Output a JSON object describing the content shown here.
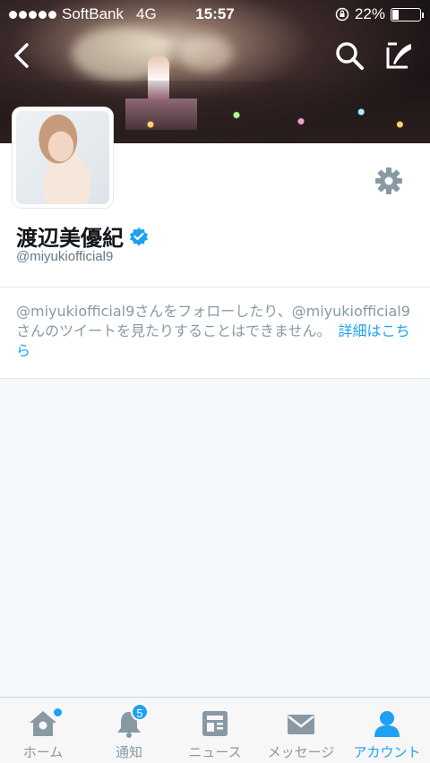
{
  "status_bar": {
    "carrier": "SoftBank",
    "network": "4G",
    "time": "15:57",
    "battery_text": "22%",
    "battery_level": 0.22,
    "signal_bars_filled": 5
  },
  "header": {
    "back_icon": "chevron-left-icon",
    "search_icon": "search-icon",
    "compose_icon": "compose-tweet-icon"
  },
  "profile": {
    "name": "渡辺美優紀",
    "handle": "@miyukiofficial9",
    "verified": true,
    "settings_icon": "gear-icon"
  },
  "protected_notice": {
    "text": "@miyukiofficial9さんをフォローしたり、@miyukiofficial9さんのツイートを見たりすることはできません。",
    "link_label": "詳細はこちら"
  },
  "tabbar": {
    "tabs": [
      {
        "label": "ホーム",
        "icon": "home-icon",
        "active": false,
        "dot": true
      },
      {
        "label": "通知",
        "icon": "bell-icon",
        "active": false,
        "badge": "5"
      },
      {
        "label": "ニュース",
        "icon": "news-icon",
        "active": false
      },
      {
        "label": "メッセージ",
        "icon": "envelope-icon",
        "active": false
      },
      {
        "label": "アカウント",
        "icon": "person-icon",
        "active": true
      }
    ]
  },
  "colors": {
    "accent": "#1da1f2",
    "inactive": "#8899a6",
    "background": "#f5f8fa"
  }
}
